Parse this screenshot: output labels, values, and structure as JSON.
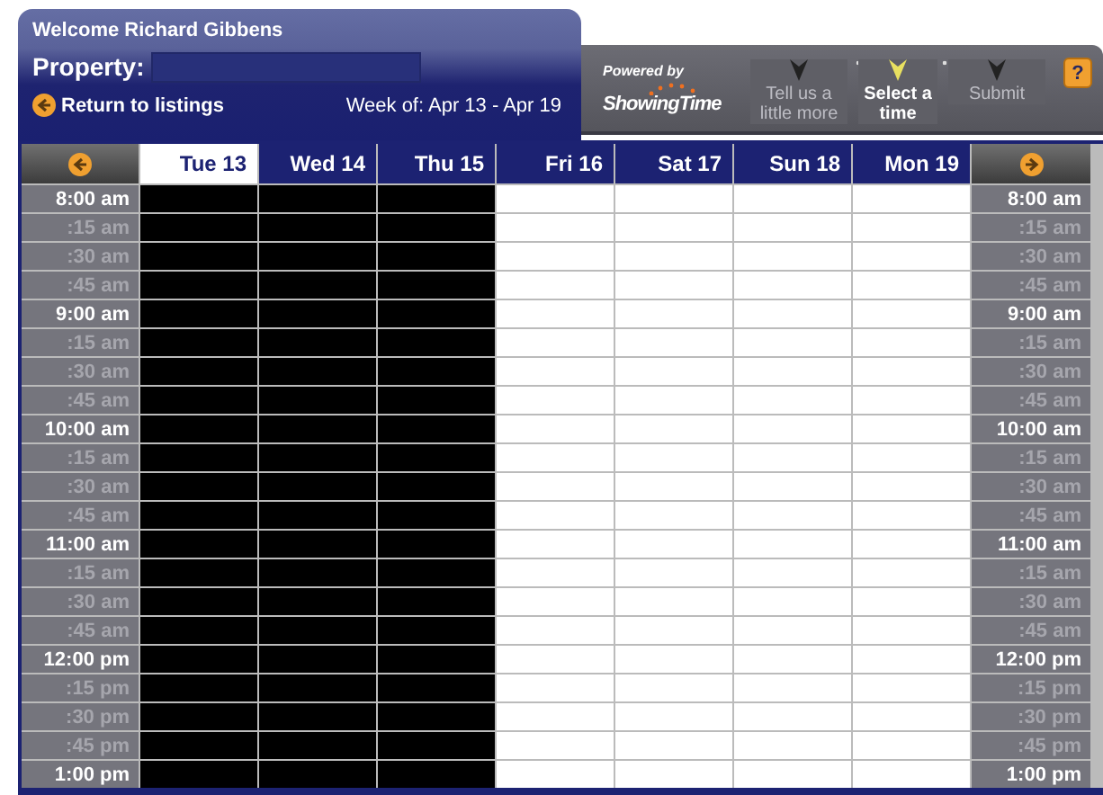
{
  "header": {
    "welcome": "Welcome Richard Gibbens",
    "property_label": "Property:",
    "return_link": "Return to listings",
    "week": "Week of: Apr 13 - Apr 19"
  },
  "branding": {
    "powered_by": "Powered by",
    "logo": "ShowingTime"
  },
  "steps": [
    {
      "label": "Tell us a little more",
      "selected": false
    },
    {
      "label": "Select a time",
      "selected": true
    },
    {
      "label": "Submit",
      "selected": false
    }
  ],
  "help_button": "?",
  "calendar": {
    "days": [
      {
        "label": "Tue 13",
        "selected": true,
        "blocked": true
      },
      {
        "label": "Wed 14",
        "selected": false,
        "blocked": true
      },
      {
        "label": "Thu 15",
        "selected": false,
        "blocked": true
      },
      {
        "label": "Fri 16",
        "selected": false,
        "blocked": false
      },
      {
        "label": "Sat 17",
        "selected": false,
        "blocked": false
      },
      {
        "label": "Sun 18",
        "selected": false,
        "blocked": false
      },
      {
        "label": "Mon 19",
        "selected": false,
        "blocked": false
      }
    ],
    "times": [
      {
        "left": "8:00 am",
        "right": "8:00 am",
        "kind": "hour"
      },
      {
        "left": ":15 am",
        "right": ":15 am",
        "kind": "quarter"
      },
      {
        "left": ":30 am",
        "right": ":30 am",
        "kind": "quarter"
      },
      {
        "left": ":45 am",
        "right": ":45 am",
        "kind": "quarter"
      },
      {
        "left": "9:00 am",
        "right": "9:00 am",
        "kind": "hour"
      },
      {
        "left": ":15 am",
        "right": ":15 am",
        "kind": "quarter"
      },
      {
        "left": ":30 am",
        "right": ":30 am",
        "kind": "quarter"
      },
      {
        "left": ":45 am",
        "right": ":45 am",
        "kind": "quarter"
      },
      {
        "left": "10:00 am",
        "right": "10:00 am",
        "kind": "hour"
      },
      {
        "left": ":15 am",
        "right": ":15 am",
        "kind": "quarter"
      },
      {
        "left": ":30 am",
        "right": ":30 am",
        "kind": "quarter"
      },
      {
        "left": ":45 am",
        "right": ":45 am",
        "kind": "quarter"
      },
      {
        "left": "11:00 am",
        "right": "11:00 am",
        "kind": "hour"
      },
      {
        "left": ":15 am",
        "right": ":15 am",
        "kind": "quarter"
      },
      {
        "left": ":30 am",
        "right": ":30 am",
        "kind": "quarter"
      },
      {
        "left": ":45 am",
        "right": ":45 am",
        "kind": "quarter"
      },
      {
        "left": "12:00 pm",
        "right": "12:00 pm",
        "kind": "hour"
      },
      {
        "left": ":15 pm",
        "right": ":15 pm",
        "kind": "quarter"
      },
      {
        "left": ":30 pm",
        "right": ":30 pm",
        "kind": "quarter"
      },
      {
        "left": ":45 pm",
        "right": ":45 pm",
        "kind": "quarter"
      },
      {
        "left": "1:00 pm",
        "right": "1:00 pm",
        "kind": "hour"
      }
    ]
  }
}
